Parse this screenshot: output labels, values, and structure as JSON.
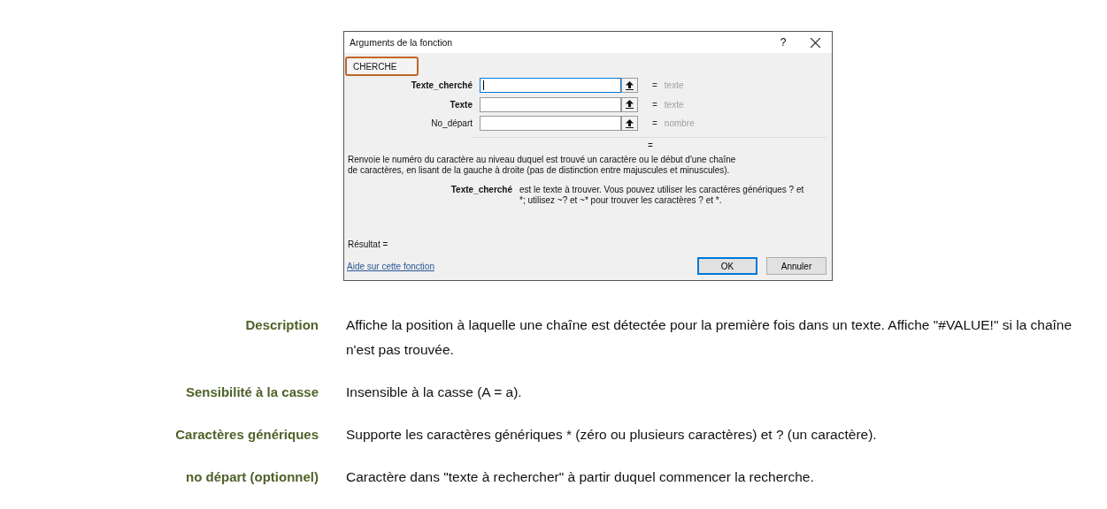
{
  "dialog": {
    "title": "Arguments de la fonction",
    "help": "?",
    "function_name": "CHERCHE",
    "arguments": [
      {
        "label": "Texte_cherché",
        "hint": "texte",
        "focused": true
      },
      {
        "label": "Texte",
        "hint": "texte",
        "focused": false
      },
      {
        "label": "No_départ",
        "hint": "nombre",
        "focused": false
      }
    ],
    "equals": "=",
    "result_equals": "=",
    "description": "Renvoie le numéro du caractère au niveau duquel est trouvé un caractère ou le début d'une chaîne de caractères, en lisant de la gauche à droite (pas de distinction entre majuscules et minuscules).",
    "argument_help": {
      "label": "Texte_cherché",
      "text": "est le texte à trouver. Vous pouvez utiliser les caractères génériques ? et *; utilisez ~? et ~* pour trouver les caractères ? et *."
    },
    "result": "Résultat =",
    "help_link": "Aide sur cette fonction",
    "buttons": [
      {
        "label": "OK",
        "default": true
      },
      {
        "label": "Annuler",
        "default": false
      }
    ]
  },
  "properties": [
    {
      "label": "Description",
      "value": "Affiche la position à laquelle une chaîne est détectée pour la première fois dans un texte. Affiche \"#VALUE!\" si la chaîne n'est pas trouvée."
    },
    {
      "label": "Sensibilité à la casse",
      "value": "Insensible à la casse (A = a)."
    },
    {
      "label": "Caractères génériques",
      "value": "Supporte les caractères génériques * (zéro ou plusieurs caractères) et ? (un caractère)."
    },
    {
      "label": "no  départ (optionnel)",
      "value": "Caractère dans \"texte  à  rechercher\" à partir duquel commencer la recherche."
    }
  ]
}
